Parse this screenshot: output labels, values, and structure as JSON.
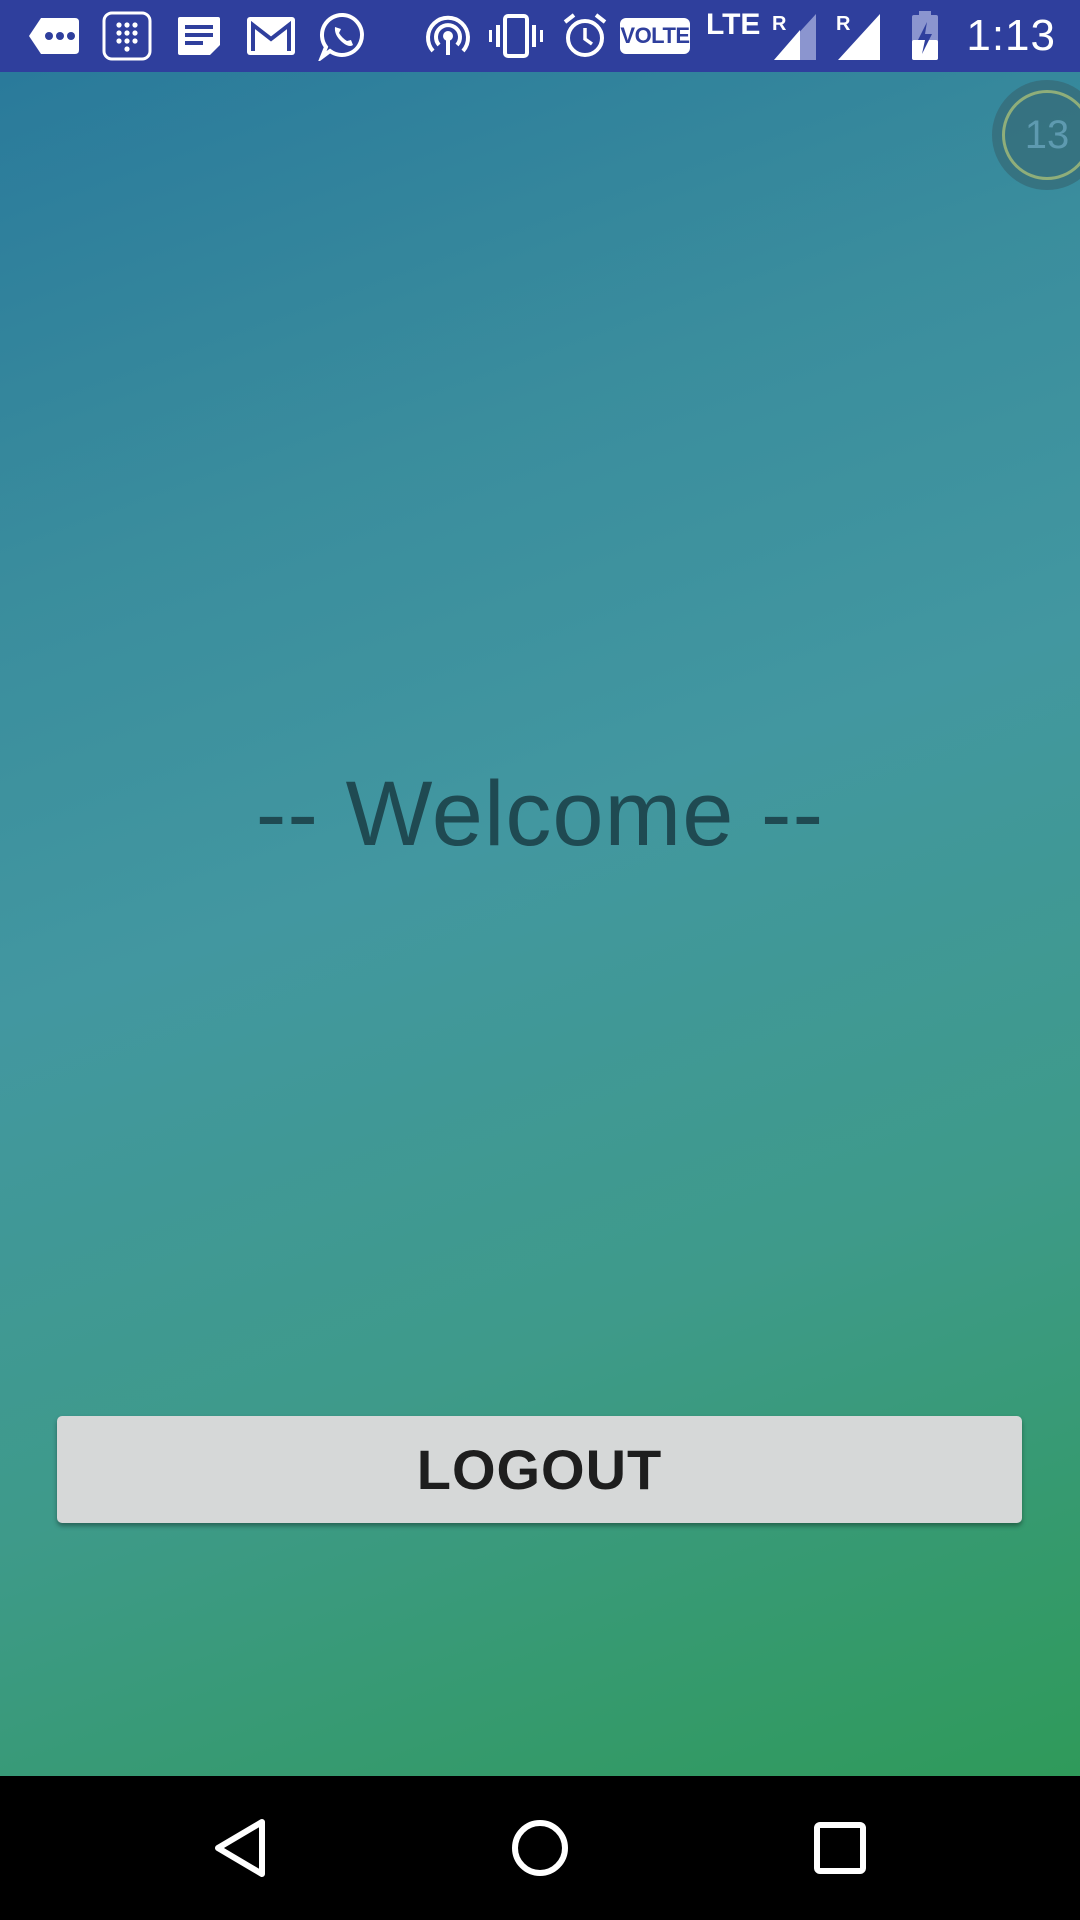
{
  "status_bar": {
    "time": "1:13",
    "volte_label": "VOLTE",
    "network_label": "LTE",
    "background_color": "#2f3f9d",
    "notification_icons": [
      "sms-icon",
      "dialpad-icon",
      "notes-icon",
      "gmail-icon",
      "whatsapp-icon"
    ],
    "system_icons": [
      "hotspot-icon",
      "vibrate-icon",
      "alarm-icon",
      "signal-roaming-icon",
      "signal-roaming-icon",
      "battery-charging-icon"
    ]
  },
  "floating_bubble": {
    "count": "13"
  },
  "main": {
    "welcome_text": "-- Welcome --",
    "logout_label": "LOGOUT"
  },
  "nav_bar": {
    "buttons": [
      "back-icon",
      "home-icon",
      "recents-icon"
    ]
  }
}
